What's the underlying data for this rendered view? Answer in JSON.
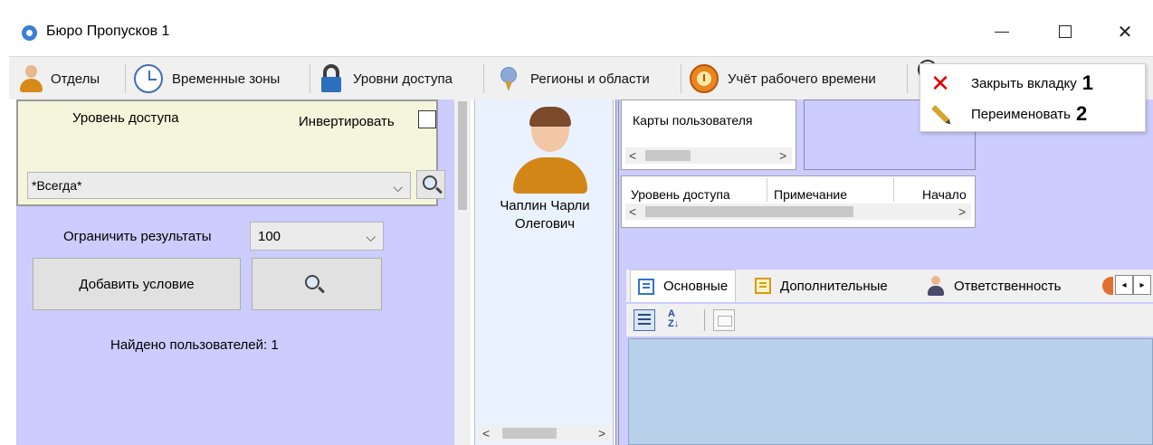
{
  "window": {
    "title": "Бюро Пропусков 1",
    "minimize": "—",
    "close": "✕"
  },
  "tabs": [
    {
      "label": "Отделы",
      "icon": "person-icon"
    },
    {
      "label": "Временные зоны",
      "icon": "clock-icon"
    },
    {
      "label": "Уровни доступа",
      "icon": "lock-icon"
    },
    {
      "label": "Регионы и области",
      "icon": "pin-icon"
    },
    {
      "label": "Учёт рабочего времени",
      "icon": "work-time-icon"
    }
  ],
  "context_menu": {
    "items": [
      {
        "label": "Закрыть вкладку",
        "number": "1",
        "icon": "close-icon"
      },
      {
        "label": "Переименовать",
        "number": "2",
        "icon": "pencil-icon"
      }
    ]
  },
  "filter": {
    "level_label": "Уровень доступа",
    "invert_label": "Инвертировать",
    "invert_checked": false,
    "level_value": "*Всегда*",
    "limit_label": "Ограничить результаты",
    "limit_value": "100",
    "add_condition_label": "Добавить условие",
    "found_text": "Найдено пользователей: 1"
  },
  "user": {
    "name": "Чаплин Чарли Олегович"
  },
  "details": {
    "cards_title": "Карты пользователя",
    "grid_headers": [
      "Уровень доступа",
      "Примечание",
      "Начало"
    ]
  },
  "property_tabs": [
    {
      "label": "Основные",
      "active": true
    },
    {
      "label": "Дополнительные",
      "active": false
    },
    {
      "label": "Ответственность",
      "active": false
    }
  ],
  "colors": {
    "panel_bg": "#ccccff",
    "filter_bg": "#f5f5dc",
    "user_panel_bg": "#eaf2ff",
    "props_grid_bg": "#b8d0ea",
    "close_red": "#e00000"
  }
}
